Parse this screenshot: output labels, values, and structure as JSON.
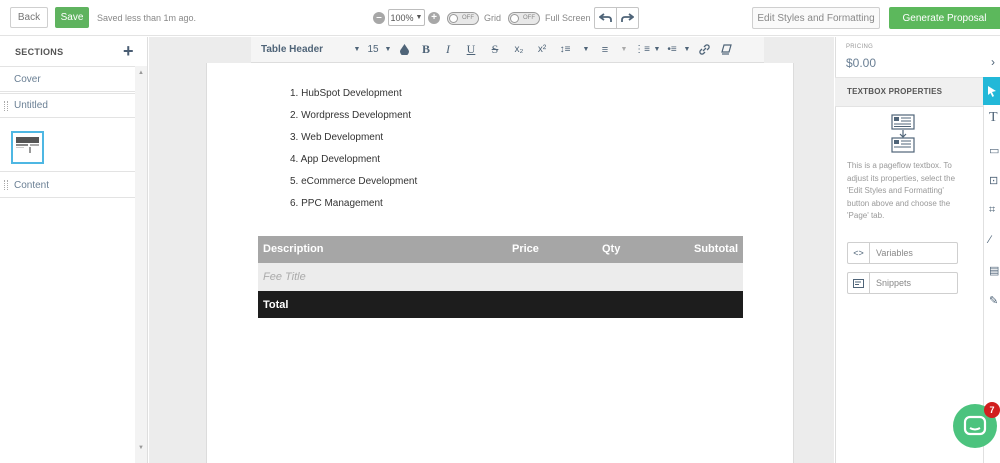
{
  "topbar": {
    "back_label": "Back",
    "save_label": "Save",
    "saved_status": "Saved less than 1m ago.",
    "zoom_value": "100%",
    "grid_label": "Grid",
    "grid_toggle": "OFF",
    "fullscreen_label": "Full Screen",
    "fullscreen_toggle": "OFF",
    "edit_styles_label": "Edit Styles and Formatting",
    "generate_label": "Generate Proposal"
  },
  "sidebar": {
    "title": "SECTIONS",
    "items": [
      {
        "label": "Cover"
      },
      {
        "label": "Untitled"
      },
      {
        "label": "Content"
      }
    ]
  },
  "toolbar": {
    "style_select": "Table Header",
    "font_size": "15"
  },
  "document": {
    "list": [
      "1. HubSpot Development",
      "2. Wordpress Development",
      "3. Web Development",
      "4. App Development",
      "5. eCommerce Development",
      "6. PPC Management"
    ],
    "table": {
      "headers": [
        "Description",
        "Price",
        "Qty",
        "Subtotal"
      ],
      "row_placeholder": "Fee Title",
      "total_label": "Total"
    }
  },
  "right_panel": {
    "pricing_label": "PRICING",
    "pricing_value": "$0.00",
    "props_title": "TEXTBOX PROPERTIES",
    "props_description": "This is a pageflow textbox. To adjust its properties, select the 'Edit Styles and Formatting' button above and choose the 'Page' tab.",
    "variables_label": "Variables",
    "snippets_label": "Snippets"
  },
  "chat": {
    "badge_count": "7"
  },
  "colors": {
    "save_green": "#5fb35f",
    "generate_green": "#5cb85c",
    "accent_blue": "#22b8d8",
    "table_header_gray": "#a6a6a6",
    "table_total_black": "#1d1d1d"
  }
}
